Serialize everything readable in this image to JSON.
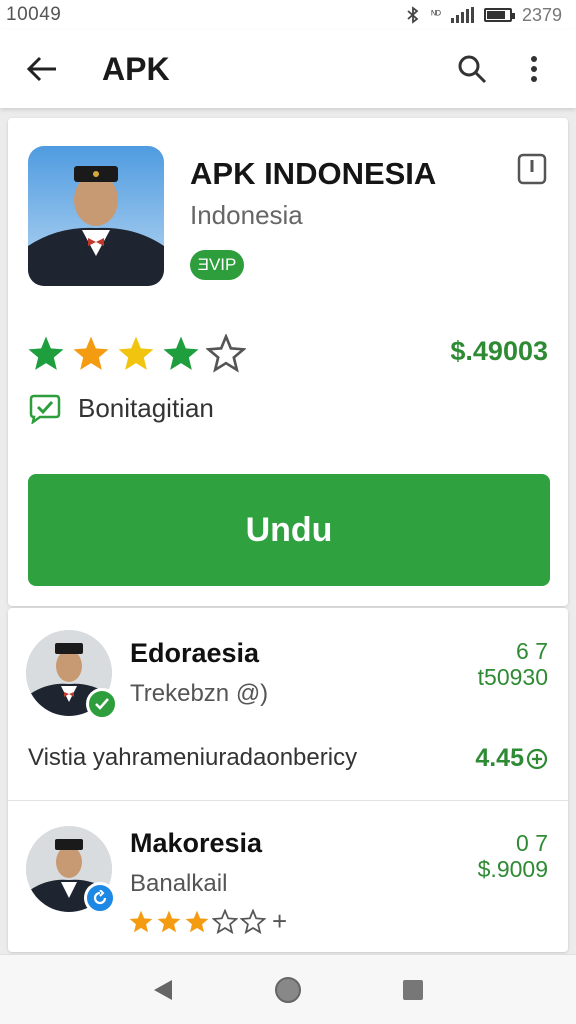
{
  "status_bar": {
    "time": "10049",
    "network_label": "ᴺᴰ",
    "battery_text": "2379",
    "battery_level": 0.8
  },
  "app_bar": {
    "title": "APK",
    "icons": [
      "back-arrow-icon",
      "search-icon",
      "more-vert-icon"
    ]
  },
  "app": {
    "title": "APK INDONESIA",
    "subtitle": "Indonesia",
    "badge": "ƎVIP",
    "rating_stars": [
      "green",
      "orange",
      "yellow",
      "green",
      "empty"
    ],
    "price": "$.49003",
    "verified_label": "Bonitagitian",
    "cta_label": "Undu"
  },
  "list": [
    {
      "name": "Edoraesia",
      "subtitle": "Trekebzn @)",
      "right_top": "6 7",
      "right_bottom": "t50930",
      "description": "Vistia yahrameniuradaonbericy",
      "score": "4.45",
      "status_icon": "check-icon"
    },
    {
      "name": "Makoresia",
      "subtitle": "Banalkail",
      "right_top": "0 7",
      "right_bottom": "$.9009",
      "rating": 3,
      "rating_max": 5,
      "rating_suffix": "+",
      "status_icon": "refresh-icon"
    }
  ],
  "colors": {
    "accent_green": "#2fa13f",
    "price_green": "#2e8b34",
    "star_orange": "#f39c12",
    "star_yellow": "#f1c40f",
    "star_green": "#1e9e3c",
    "badge_blue": "#1e88e5"
  }
}
